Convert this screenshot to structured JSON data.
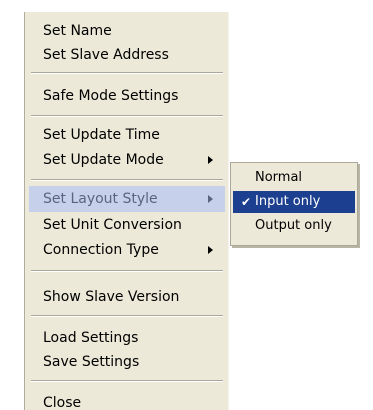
{
  "menu": {
    "items": [
      {
        "label": "Set Name"
      },
      {
        "label": "Set Slave Address"
      },
      {
        "label": "Safe Mode Settings"
      },
      {
        "label": "Set Update Time"
      },
      {
        "label": "Set Update Mode",
        "has_submenu": true
      },
      {
        "label": "Set Layout Style",
        "has_submenu": true,
        "highlighted": true
      },
      {
        "label": "Set Unit Conversion"
      },
      {
        "label": "Connection Type",
        "has_submenu": true
      },
      {
        "label": "Show Slave Version"
      },
      {
        "label": "Load Settings"
      },
      {
        "label": "Save Settings"
      },
      {
        "label": "Close"
      }
    ]
  },
  "submenu": {
    "parent": "Set Layout Style",
    "items": [
      {
        "label": "Normal",
        "checked": false
      },
      {
        "label": "Input only",
        "checked": true,
        "highlighted": true
      },
      {
        "label": "Output only",
        "checked": false
      }
    ]
  },
  "colors": {
    "menu_background": "#ece9d8",
    "selected_item_background": "#c6d0ea",
    "submenu_highlight": "#1c3f8f"
  },
  "icons": {
    "submenu_arrow": "chevron-right-icon",
    "check": "checkmark-icon"
  }
}
